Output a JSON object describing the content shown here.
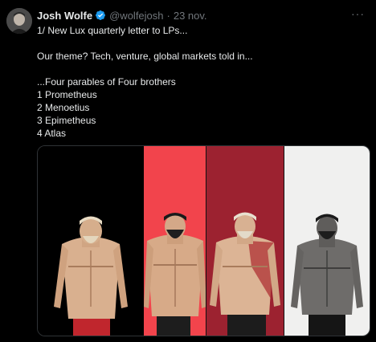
{
  "author": {
    "name": "Josh Wolfe",
    "handle": "@wolfejosh",
    "separator": "·",
    "date": "23 nov."
  },
  "more_label": "···",
  "text_lines": [
    "1/ New Lux quarterly letter to LPs...",
    "",
    "Our theme? Tech, venture, global markets told in...",
    "",
    "...Four parables of Four brothers",
    "1 Prometheus",
    "2 Menoetius",
    "3 Epimetheus",
    "4 Atlas"
  ],
  "colors": {
    "verified": "#1d9bf0",
    "panel_1": "#000000",
    "panel_2": "#f2444c",
    "panel_3": "#9c2230",
    "panel_4": "#f0f0ef"
  },
  "media": {
    "figures": [
      "prometheus-figure",
      "menoetius-figure",
      "epimetheus-figure",
      "atlas-figure"
    ]
  }
}
